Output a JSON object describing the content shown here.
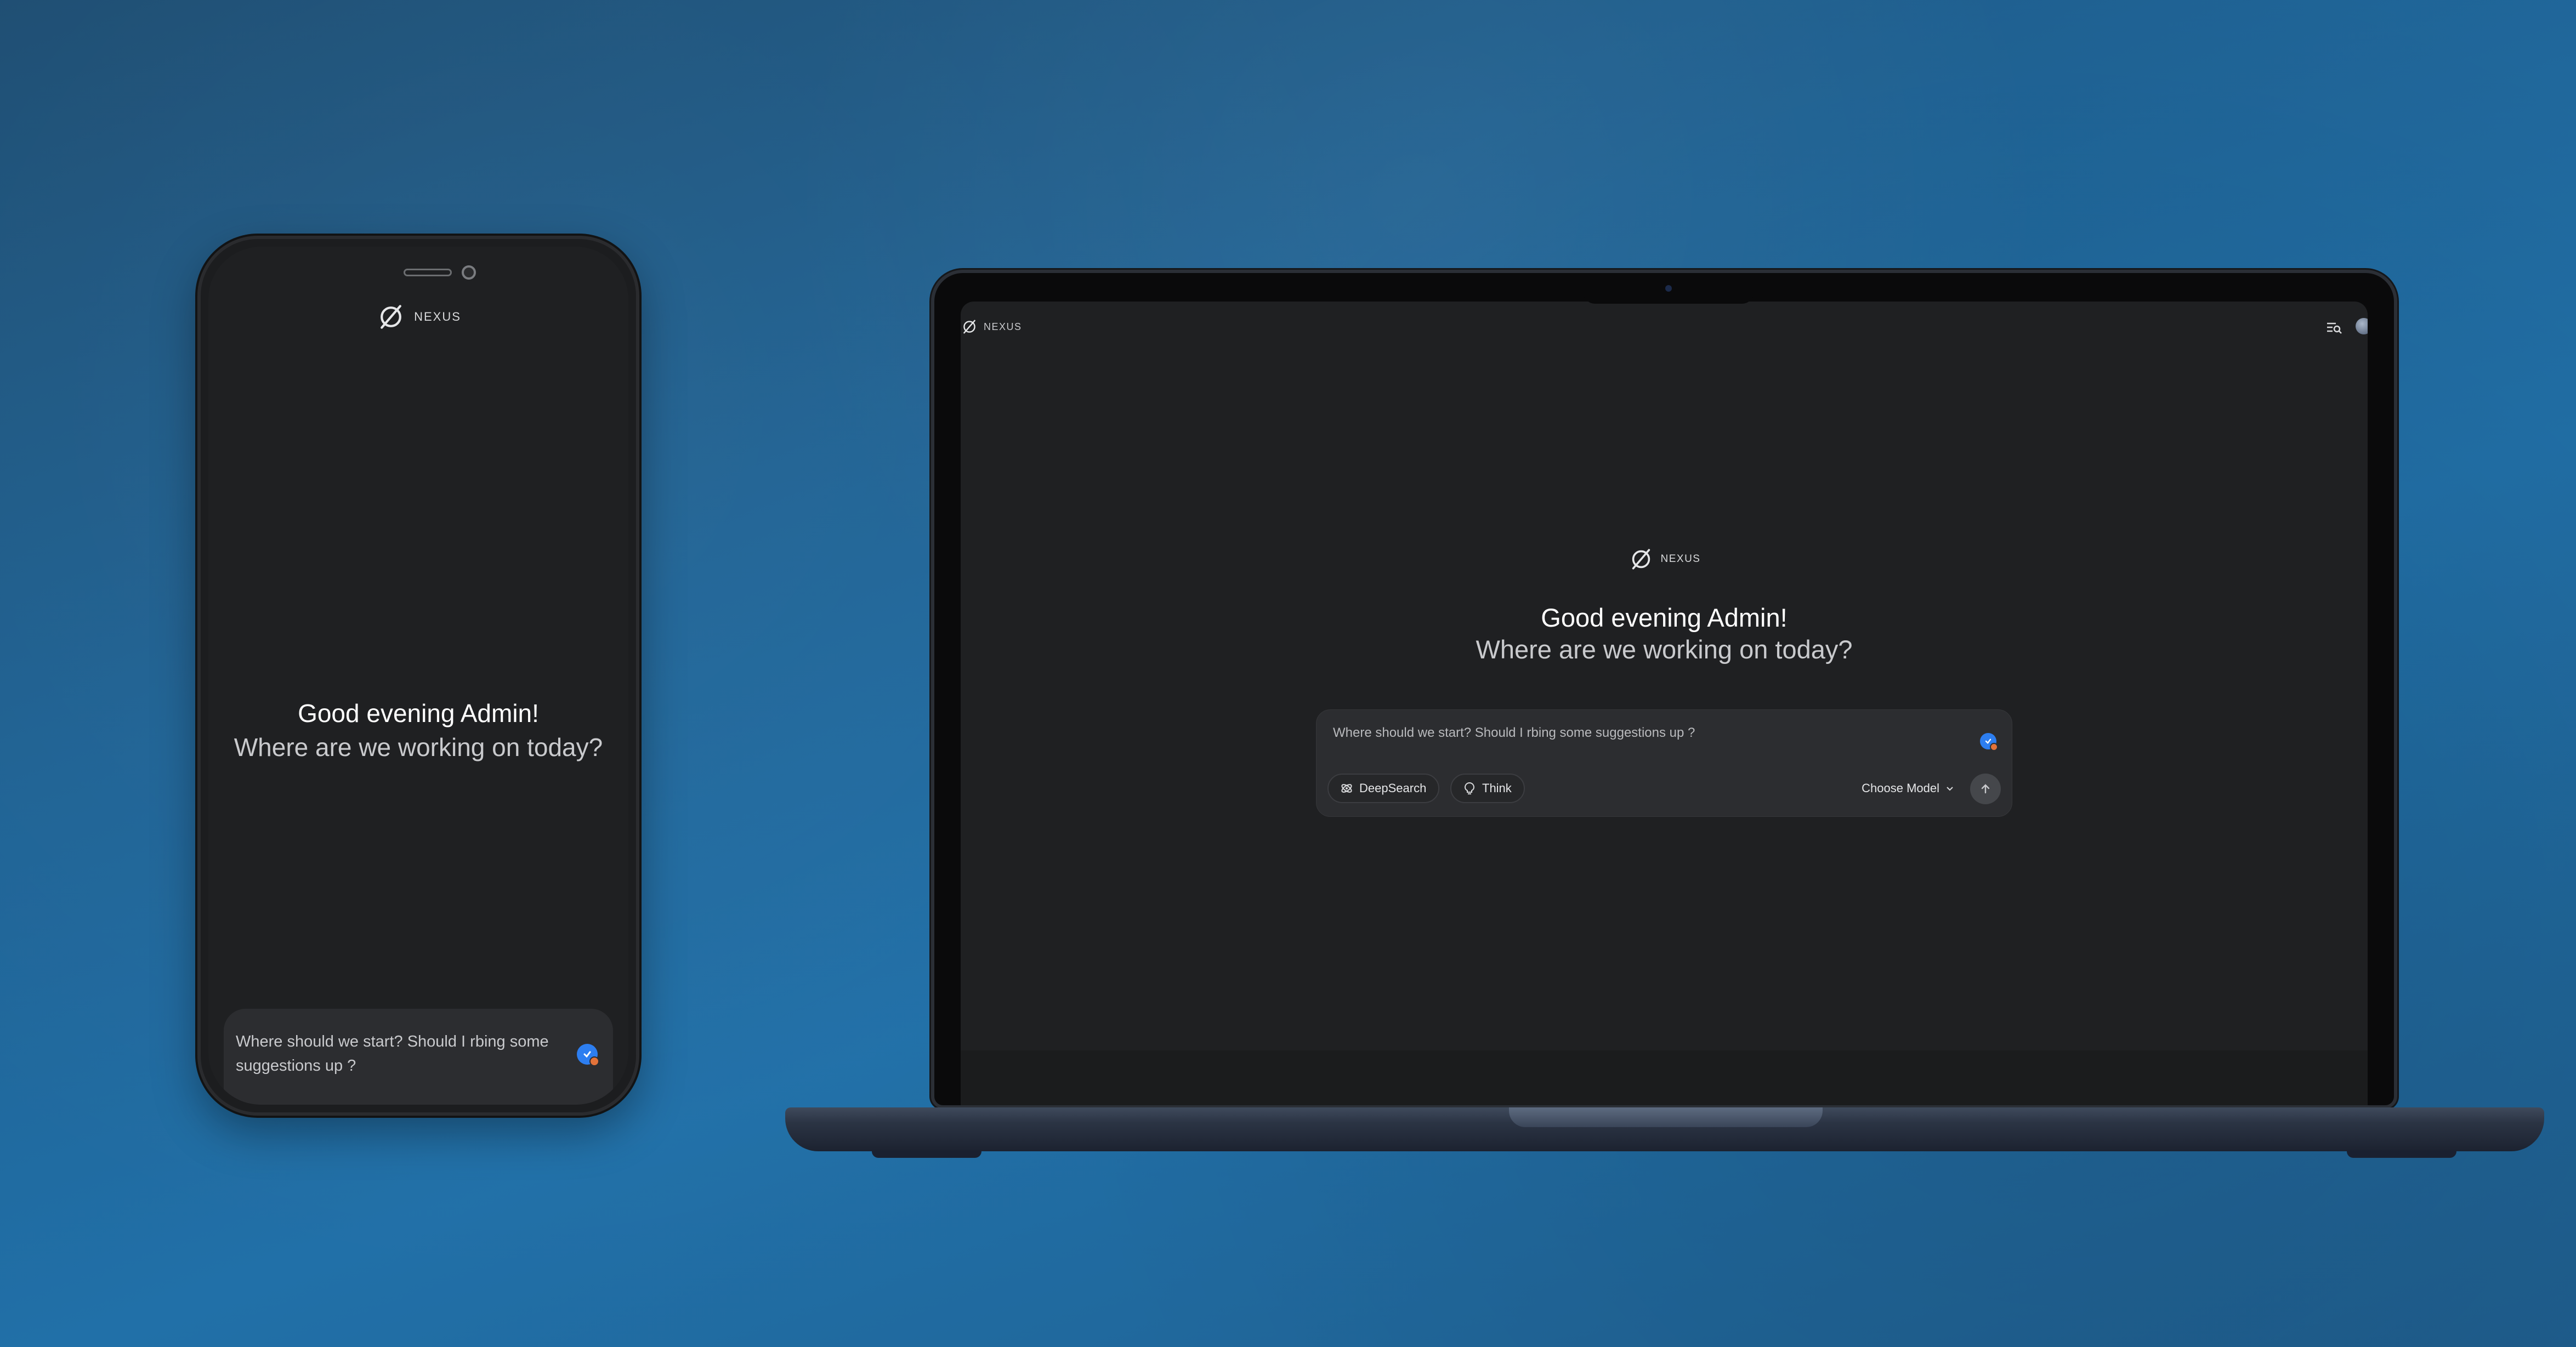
{
  "brand": {
    "name": "NEXUS"
  },
  "greeting": {
    "title": "Good evening Admin!",
    "subtitle": "Where are we working on today?"
  },
  "prompt": {
    "placeholder": "Where should we start? Should I rbing some suggestions up ?"
  },
  "toolbar": {
    "deepsearch_label": "DeepSearch",
    "think_label": "Think",
    "model_label": "Choose Model"
  },
  "icons": {
    "logo": "nexus-logo-icon",
    "deepsearch": "atom-icon",
    "think": "lightbulb-icon",
    "chevron": "chevron-down-icon",
    "send": "arrow-up-icon",
    "history": "history-search-icon",
    "attach": "check-badge-icon"
  },
  "colors": {
    "background": "#1f6395",
    "screen": "#1f2022",
    "input": "#2c2d30",
    "accent": "#2d7ef0"
  }
}
